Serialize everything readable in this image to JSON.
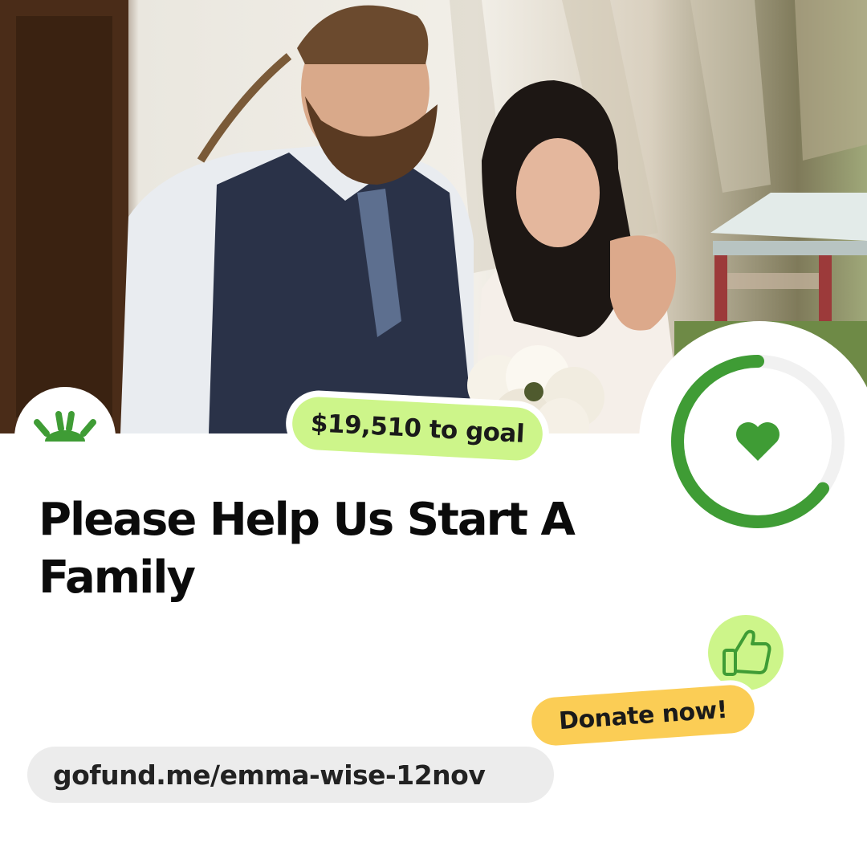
{
  "campaign": {
    "title": "Please Help Us Start A Family",
    "goal_remaining": "$19,510 to goal",
    "progress_fraction": 0.65,
    "cta_label": "Donate now!",
    "url": "gofund.me/emma-wise-12nov",
    "photo_alt": "couple-wedding-photo"
  },
  "colors": {
    "brand_green": "#3f9c35",
    "lime": "#cdf58a",
    "yellow": "#fbcd55",
    "track": "#f1f1f1",
    "url_bg": "#ececec"
  },
  "icons": {
    "logo": "gofundme-sun-logo-icon",
    "heart": "heart-icon",
    "thumb": "thumbs-up-icon"
  }
}
